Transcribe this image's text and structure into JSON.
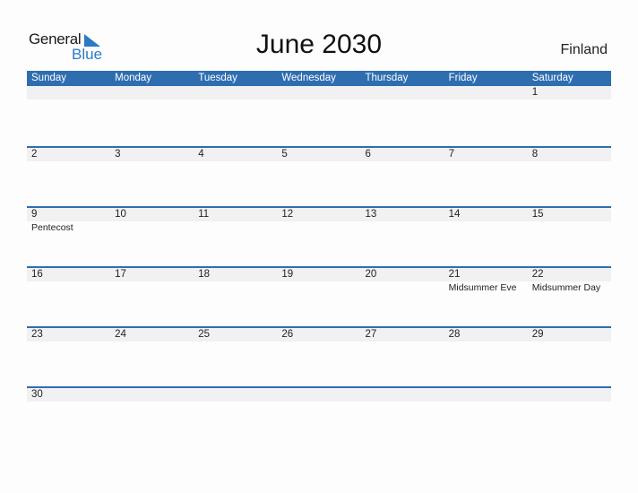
{
  "logo": {
    "word1": "General",
    "word2": "Blue"
  },
  "title": "June 2030",
  "country": "Finland",
  "colors": {
    "accent": "#2e6eb0",
    "band": "#f1f1f1"
  },
  "weekdays": [
    "Sunday",
    "Monday",
    "Tuesday",
    "Wednesday",
    "Thursday",
    "Friday",
    "Saturday"
  ],
  "weeks": [
    [
      {
        "d": ""
      },
      {
        "d": ""
      },
      {
        "d": ""
      },
      {
        "d": ""
      },
      {
        "d": ""
      },
      {
        "d": ""
      },
      {
        "d": "1"
      }
    ],
    [
      {
        "d": "2"
      },
      {
        "d": "3"
      },
      {
        "d": "4"
      },
      {
        "d": "5"
      },
      {
        "d": "6"
      },
      {
        "d": "7"
      },
      {
        "d": "8"
      }
    ],
    [
      {
        "d": "9",
        "h": "Pentecost"
      },
      {
        "d": "10"
      },
      {
        "d": "11"
      },
      {
        "d": "12"
      },
      {
        "d": "13"
      },
      {
        "d": "14"
      },
      {
        "d": "15"
      }
    ],
    [
      {
        "d": "16"
      },
      {
        "d": "17"
      },
      {
        "d": "18"
      },
      {
        "d": "19"
      },
      {
        "d": "20"
      },
      {
        "d": "21",
        "h": "Midsummer Eve"
      },
      {
        "d": "22",
        "h": "Midsummer Day"
      }
    ],
    [
      {
        "d": "23"
      },
      {
        "d": "24"
      },
      {
        "d": "25"
      },
      {
        "d": "26"
      },
      {
        "d": "27"
      },
      {
        "d": "28"
      },
      {
        "d": "29"
      }
    ],
    [
      {
        "d": "30"
      },
      {
        "d": ""
      },
      {
        "d": ""
      },
      {
        "d": ""
      },
      {
        "d": ""
      },
      {
        "d": ""
      },
      {
        "d": ""
      }
    ]
  ]
}
